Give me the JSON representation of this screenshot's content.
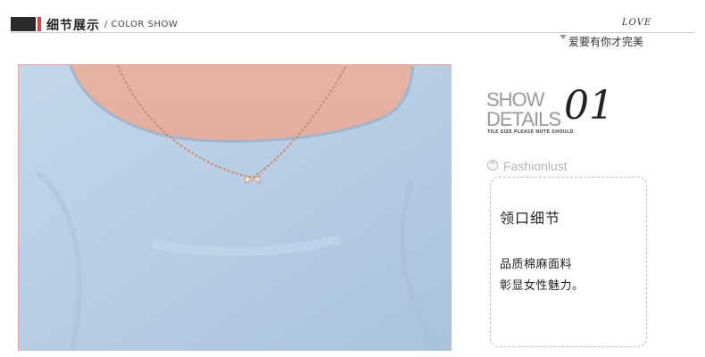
{
  "header": {
    "title": "细节展示",
    "subtitle": "/ COLOR SHOW",
    "love": "LOVE",
    "slogan": "爱要有你才完美"
  },
  "panel": {
    "show": "SHOW",
    "details": "DETAILS",
    "number": "01",
    "note": "TILE SIZE PLEASE NOTE SHOULD",
    "brand": "Fashionlust"
  },
  "card": {
    "title": "领口细节",
    "line1": "品质棉麻面料",
    "line2": "彰显女性魅力。"
  },
  "colors": {
    "accent": "#e0443c",
    "fabric": "#b9cfe6",
    "skin": "#e4ad9c"
  }
}
